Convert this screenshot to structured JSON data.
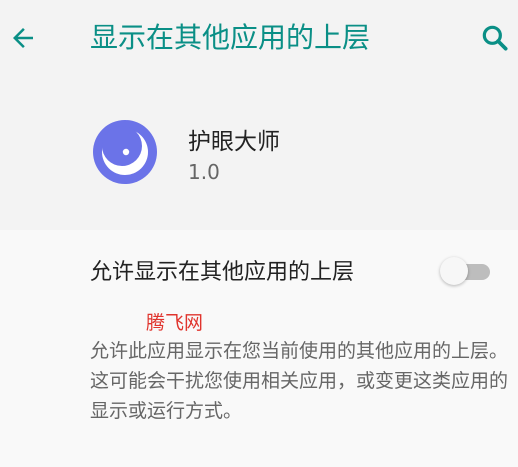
{
  "toolbar": {
    "back_icon": "arrow-left-icon",
    "title": "显示在其他应用的上层",
    "search_icon": "search-icon",
    "accent": "#0a8f86"
  },
  "app": {
    "icon": "moon-icon",
    "name": "护眼大师",
    "version": "1.0",
    "icon_color": "#6b73e8"
  },
  "permission": {
    "label": "允许显示在其他应用的上层",
    "enabled": false,
    "description": "允许此应用显示在您当前使用的其他应用的上层。这可能会干扰您使用相关应用，或变更这类应用的显示或运行方式。"
  },
  "watermark": {
    "text": "腾飞网",
    "color": "#e0342d"
  }
}
